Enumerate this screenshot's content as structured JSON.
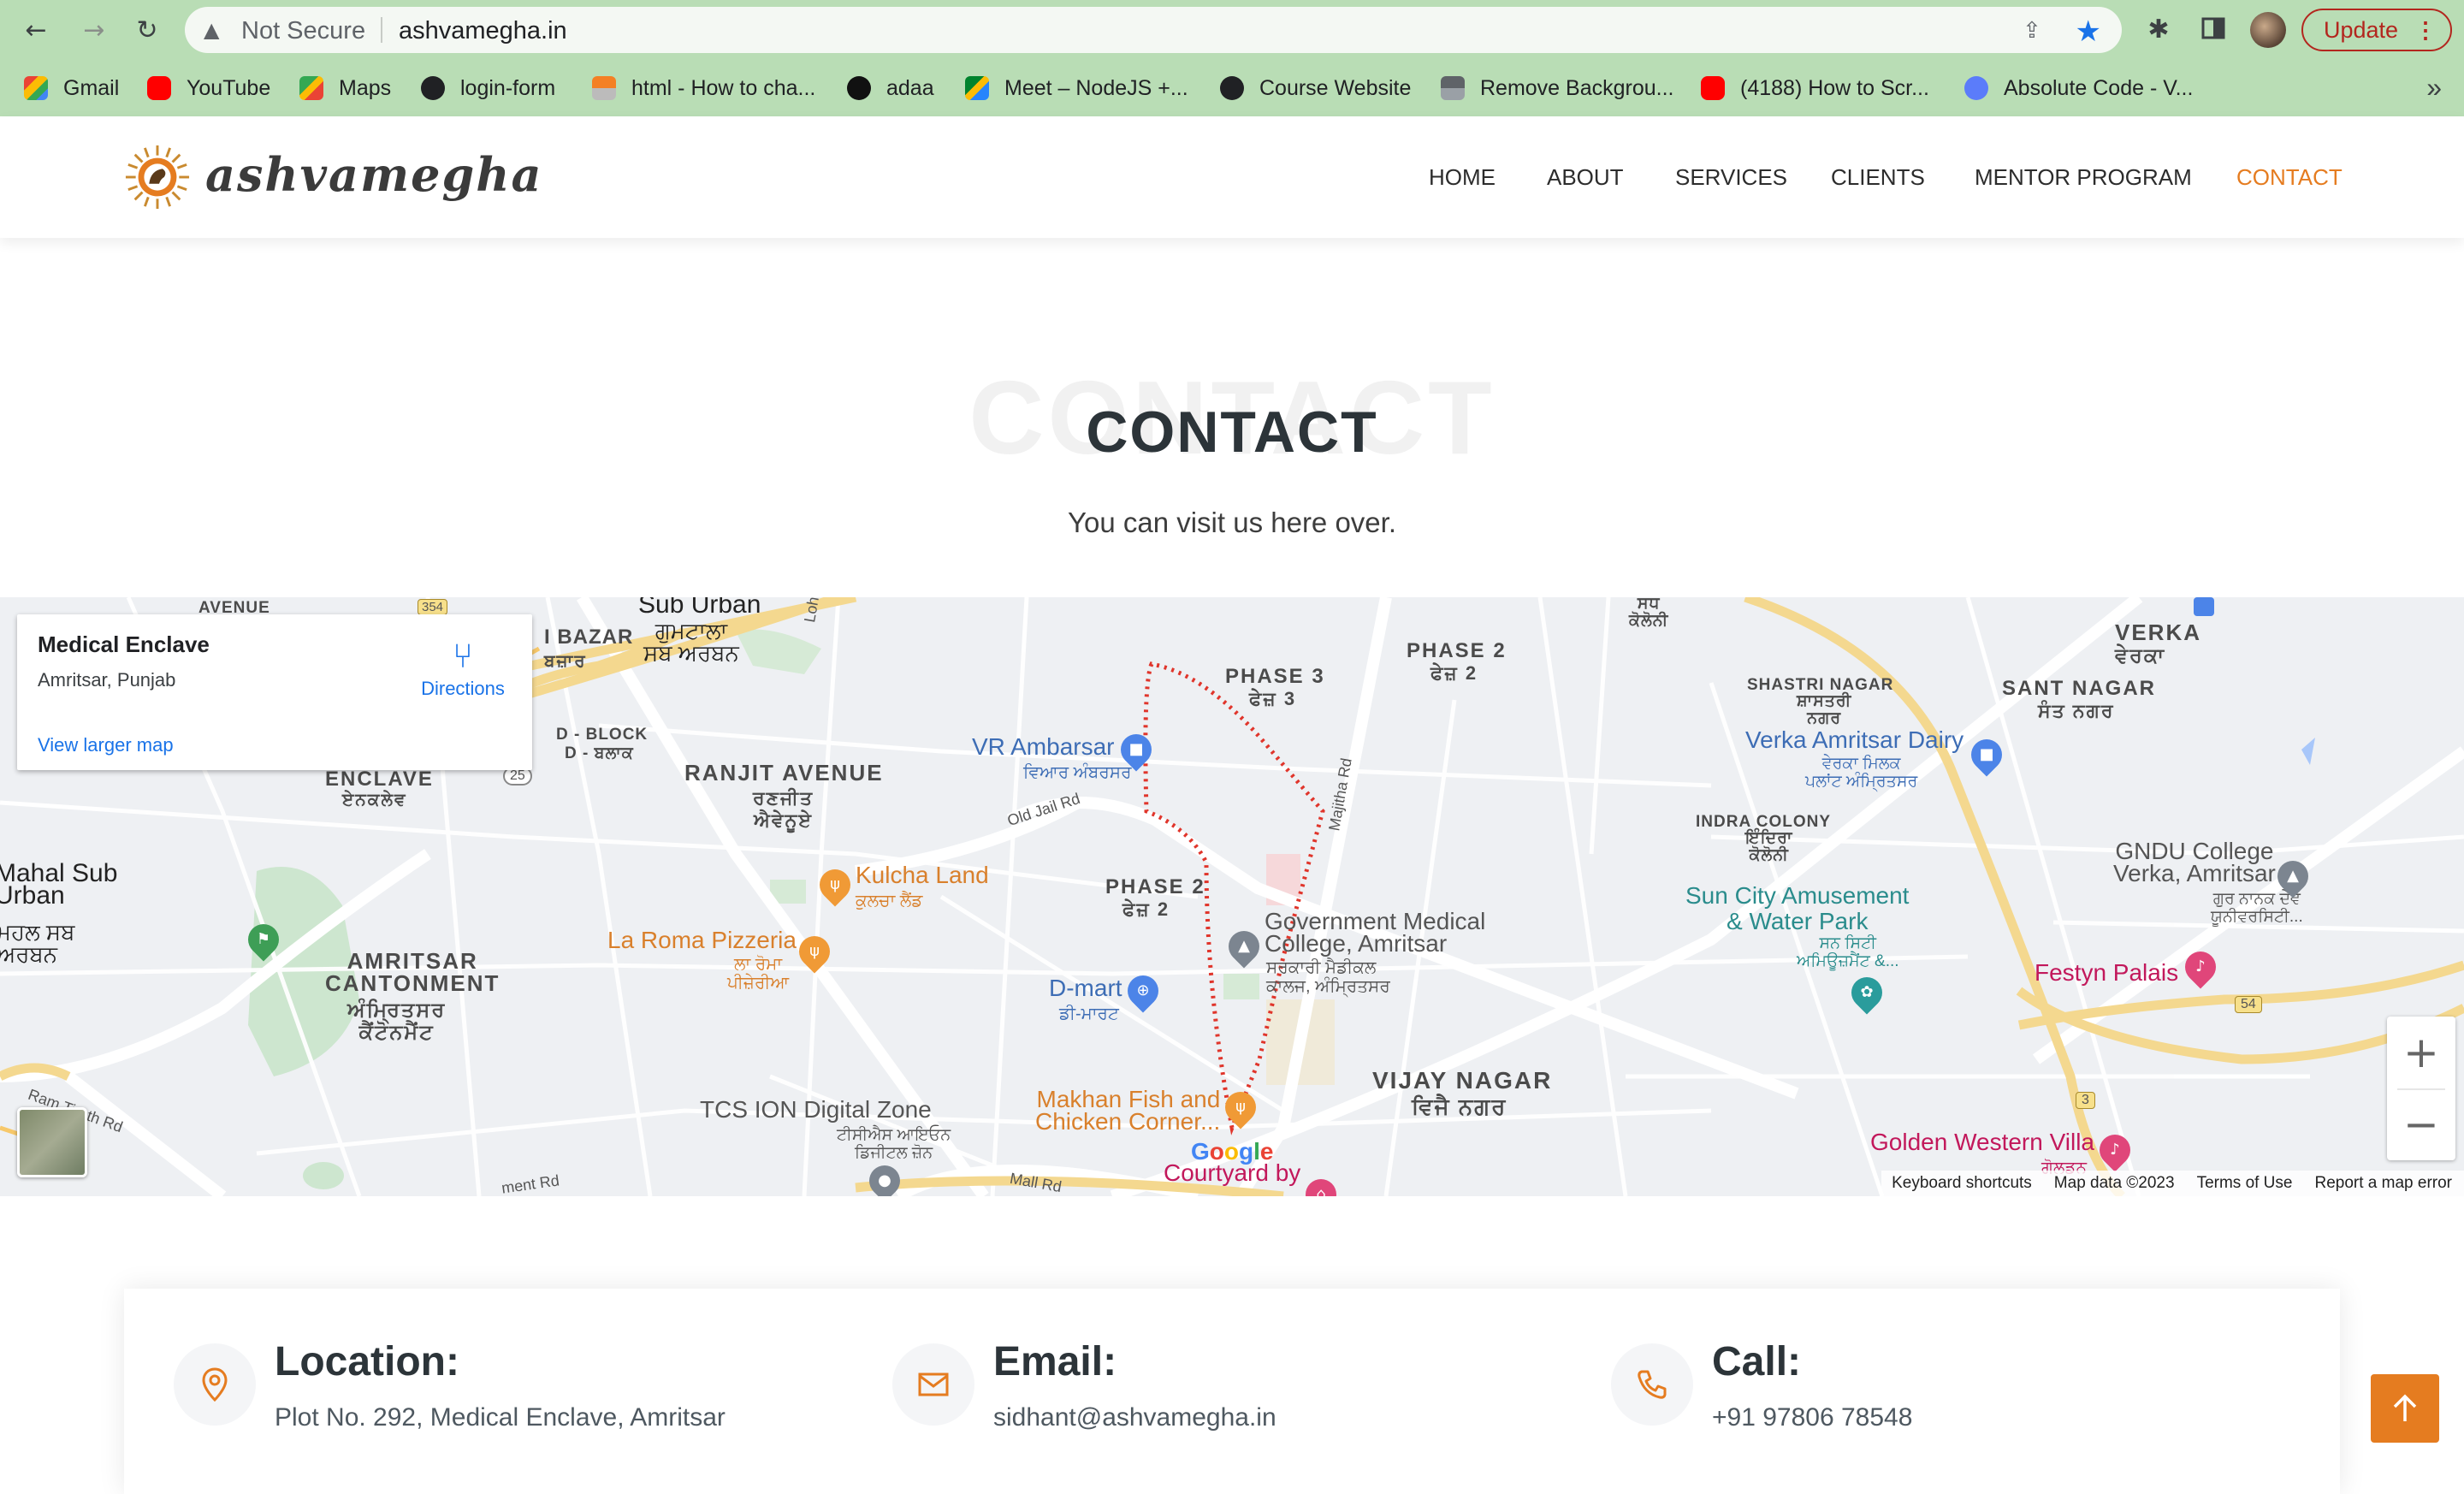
{
  "browser": {
    "security_label": "Not Secure",
    "url": "ashvamegha.in",
    "update_label": "Update",
    "bookmarks": [
      {
        "label": "Gmail"
      },
      {
        "label": "YouTube"
      },
      {
        "label": "Maps"
      },
      {
        "label": "login-form"
      },
      {
        "label": "html - How to cha..."
      },
      {
        "label": "adaa"
      },
      {
        "label": "Meet – NodeJS +..."
      },
      {
        "label": "Course Website"
      },
      {
        "label": "Remove Backgrou..."
      },
      {
        "label": "(4188) How to Scr..."
      },
      {
        "label": "Absolute Code - V..."
      }
    ]
  },
  "site": {
    "logo_text": "ashvamegha",
    "nav": [
      "HOME",
      "ABOUT",
      "SERVICES",
      "CLIENTS",
      "MENTOR PROGRAM",
      "CONTACT"
    ],
    "active_nav": "CONTACT",
    "accent_color": "#e57c20"
  },
  "section": {
    "bg_title": "CONTACT",
    "title": "CONTACT",
    "subtitle": "You can visit us here over."
  },
  "map": {
    "card": {
      "title": "Medical Enclave",
      "address": "Amritsar, Punjab",
      "directions": "Directions",
      "larger_map": "View larger map"
    },
    "labels": {
      "sub_urban": "Sub Urban",
      "sub_urban_pa": "ਗੁਮਟਾਲਾ\nਸਬ ਅਰਬਨ",
      "bazar": "I BAZAR",
      "bazar_pa": "ਬਜ਼ਾਰ",
      "d_block": "D - BLOCK",
      "d_block_pa": "D - ਬਲਾਕ",
      "enclave": "ENCLAVE",
      "enclave_pa": "ਏਨਕਲੇਵ",
      "mahal": "Mahal Sub\nUrban",
      "mahal_pa": "ਮਹਲ ਸਬ\nਅਰਬਨ",
      "ranjit": "RANJIT AVENUE",
      "ranjit_pa": "ਰਣਜੀਤ\nਐਵੇਨੂਏ",
      "cantonment": "AMRITSAR\nCANTONMENT",
      "cantonment_pa": "ਅੰਮ੍ਰਿਤਸਰ\nਕੈਂਟੋਨਮੈਂਟ",
      "vr": "VR Ambarsar",
      "vr_pa": "ਵਿਆਰ ਅੰਬਰਸਰ",
      "phase3": "PHASE 3",
      "phase3_pa": "ਫੇਜ਼ 3",
      "phase2a": "PHASE 2",
      "phase2a_pa": "ਫੇਜ਼ 2",
      "phase2b": "PHASE 2",
      "phase2b_pa": "ਫੇਜ਼ 2",
      "kulcha": "Kulcha Land",
      "kulcha_pa": "ਕੁਲਚਾ ਲੈਂਡ",
      "laroma": "La Roma Pizzeria",
      "laroma_pa": "ਲਾ ਰੋਮਾ\nਪੀਜ਼ੇਰੀਆ",
      "dmart": "D-mart",
      "dmart_pa": "ਡੀ-ਮਾਰਟ",
      "gmc": "Government Medical\nCollege, Amritsar",
      "gmc_pa": "ਸਰਕਾਰੀ ਮੈਡੀਕਲ\nਕਾਲਜ, ਅੰਮ੍ਰਿਤਸਰ",
      "tcs": "TCS ION Digital Zone",
      "tcs_pa": "ਟੀਸੀਐਸ ਆਇਓਨ\nਡਿਜੀਟਲ ਜ਼ੋਨ",
      "makhan": "Makhan Fish and\nChicken Corner...",
      "courtyard": "Courtyard by",
      "vijay": "VIJAY NAGAR",
      "vijay_pa": "ਵਿਜੈ ਨਗਰ",
      "shastri": "SHASTRI NAGAR",
      "shastri_pa": "ਸ਼ਾਸਤਰੀ\nਨਗਰ",
      "verka_dairy": "Verka Amritsar Dairy",
      "verka_dairy_pa": "ਵੇਰਕਾ ਮਿਲਕ\nਪਲਾਂਟ ਅੰਮ੍ਰਿਤਸਰ",
      "indira": "INDRA COLONY",
      "indira_pa": "ਇੰਦਿਰਾ\nਕੋਲੋਨੀ",
      "sun_city": "Sun City Amusement\n& Water Park",
      "sun_city_pa": "ਸਨ ਸਿਟੀ\nਅਮਿਊਜ਼ਮੈਂਟ &...",
      "verka": "VERKA",
      "verka_pa": "ਵੇਰਕਾ",
      "sant": "SANT NAGAR",
      "sant_pa": "ਸੰਤ ਨਗਰ",
      "gndu": "GNDU College\nVerka, Amritsar",
      "gndu_pa": "ਗੁਰ ਨਾਨਕ ਦੇਵ\nਯੂਨੀਵਰਸਿਟੀ...",
      "festyn": "Festyn Palais",
      "golden": "Golden Western Villa",
      "golden_pa": "ਗੋਲਡਨ",
      "sadh": "ਸਧ\nਕੋਲੋਨੀ",
      "avenue": "AVENUE",
      "old_jail": "Old Jail Rd",
      "majitha": "Majitha Rd",
      "ram_tirath": "Ram Tirath Rd",
      "mall": "Mall Rd",
      "ment": "ment Rd",
      "loh": "Loh",
      "r25": "25",
      "r54": "54",
      "r3": "3",
      "r354": "354"
    },
    "google": "Google",
    "attribution": [
      "Keyboard shortcuts",
      "Map data ©2023",
      "Terms of Use",
      "Report a map error"
    ]
  },
  "contact": {
    "location_h": "Location:",
    "location_v": "Plot No. 292, Medical Enclave, Amritsar",
    "email_h": "Email:",
    "email_v": "sidhant@ashvamegha.in",
    "call_h": "Call:",
    "call_v": "+91 97806 78548"
  }
}
